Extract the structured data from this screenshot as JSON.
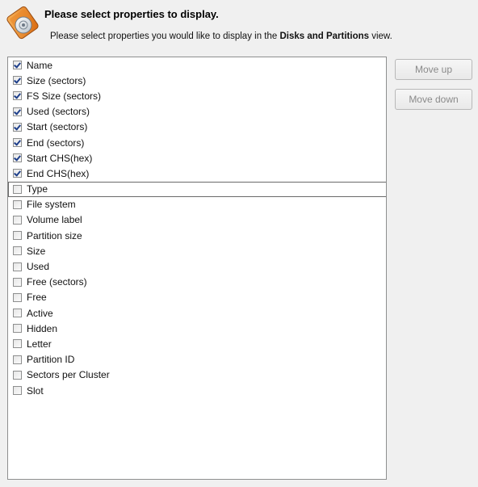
{
  "header": {
    "title": "Please select properties to display.",
    "subtitle_prefix": "Please select properties you would like to display in the ",
    "subtitle_bold": "Disks and Partitions",
    "subtitle_suffix": " view.",
    "icon": "disk-wizard-icon"
  },
  "properties": [
    {
      "label": "Name",
      "checked": true
    },
    {
      "label": "Size (sectors)",
      "checked": true
    },
    {
      "label": "FS Size (sectors)",
      "checked": true
    },
    {
      "label": "Used (sectors)",
      "checked": true
    },
    {
      "label": "Start (sectors)",
      "checked": true
    },
    {
      "label": "End (sectors)",
      "checked": true
    },
    {
      "label": "Start CHS(hex)",
      "checked": true
    },
    {
      "label": "End CHS(hex)",
      "checked": true
    },
    {
      "label": "Type",
      "checked": false,
      "focused": true
    },
    {
      "label": "File system",
      "checked": false
    },
    {
      "label": "Volume label",
      "checked": false
    },
    {
      "label": "Partition size",
      "checked": false
    },
    {
      "label": "Size",
      "checked": false
    },
    {
      "label": "Used",
      "checked": false
    },
    {
      "label": "Free (sectors)",
      "checked": false
    },
    {
      "label": "Free",
      "checked": false
    },
    {
      "label": "Active",
      "checked": false
    },
    {
      "label": "Hidden",
      "checked": false
    },
    {
      "label": "Letter",
      "checked": false
    },
    {
      "label": "Partition ID",
      "checked": false
    },
    {
      "label": "Sectors per Cluster",
      "checked": false
    },
    {
      "label": "Slot",
      "checked": false
    }
  ],
  "buttons": {
    "move_up": "Move up",
    "move_down": "Move down"
  }
}
